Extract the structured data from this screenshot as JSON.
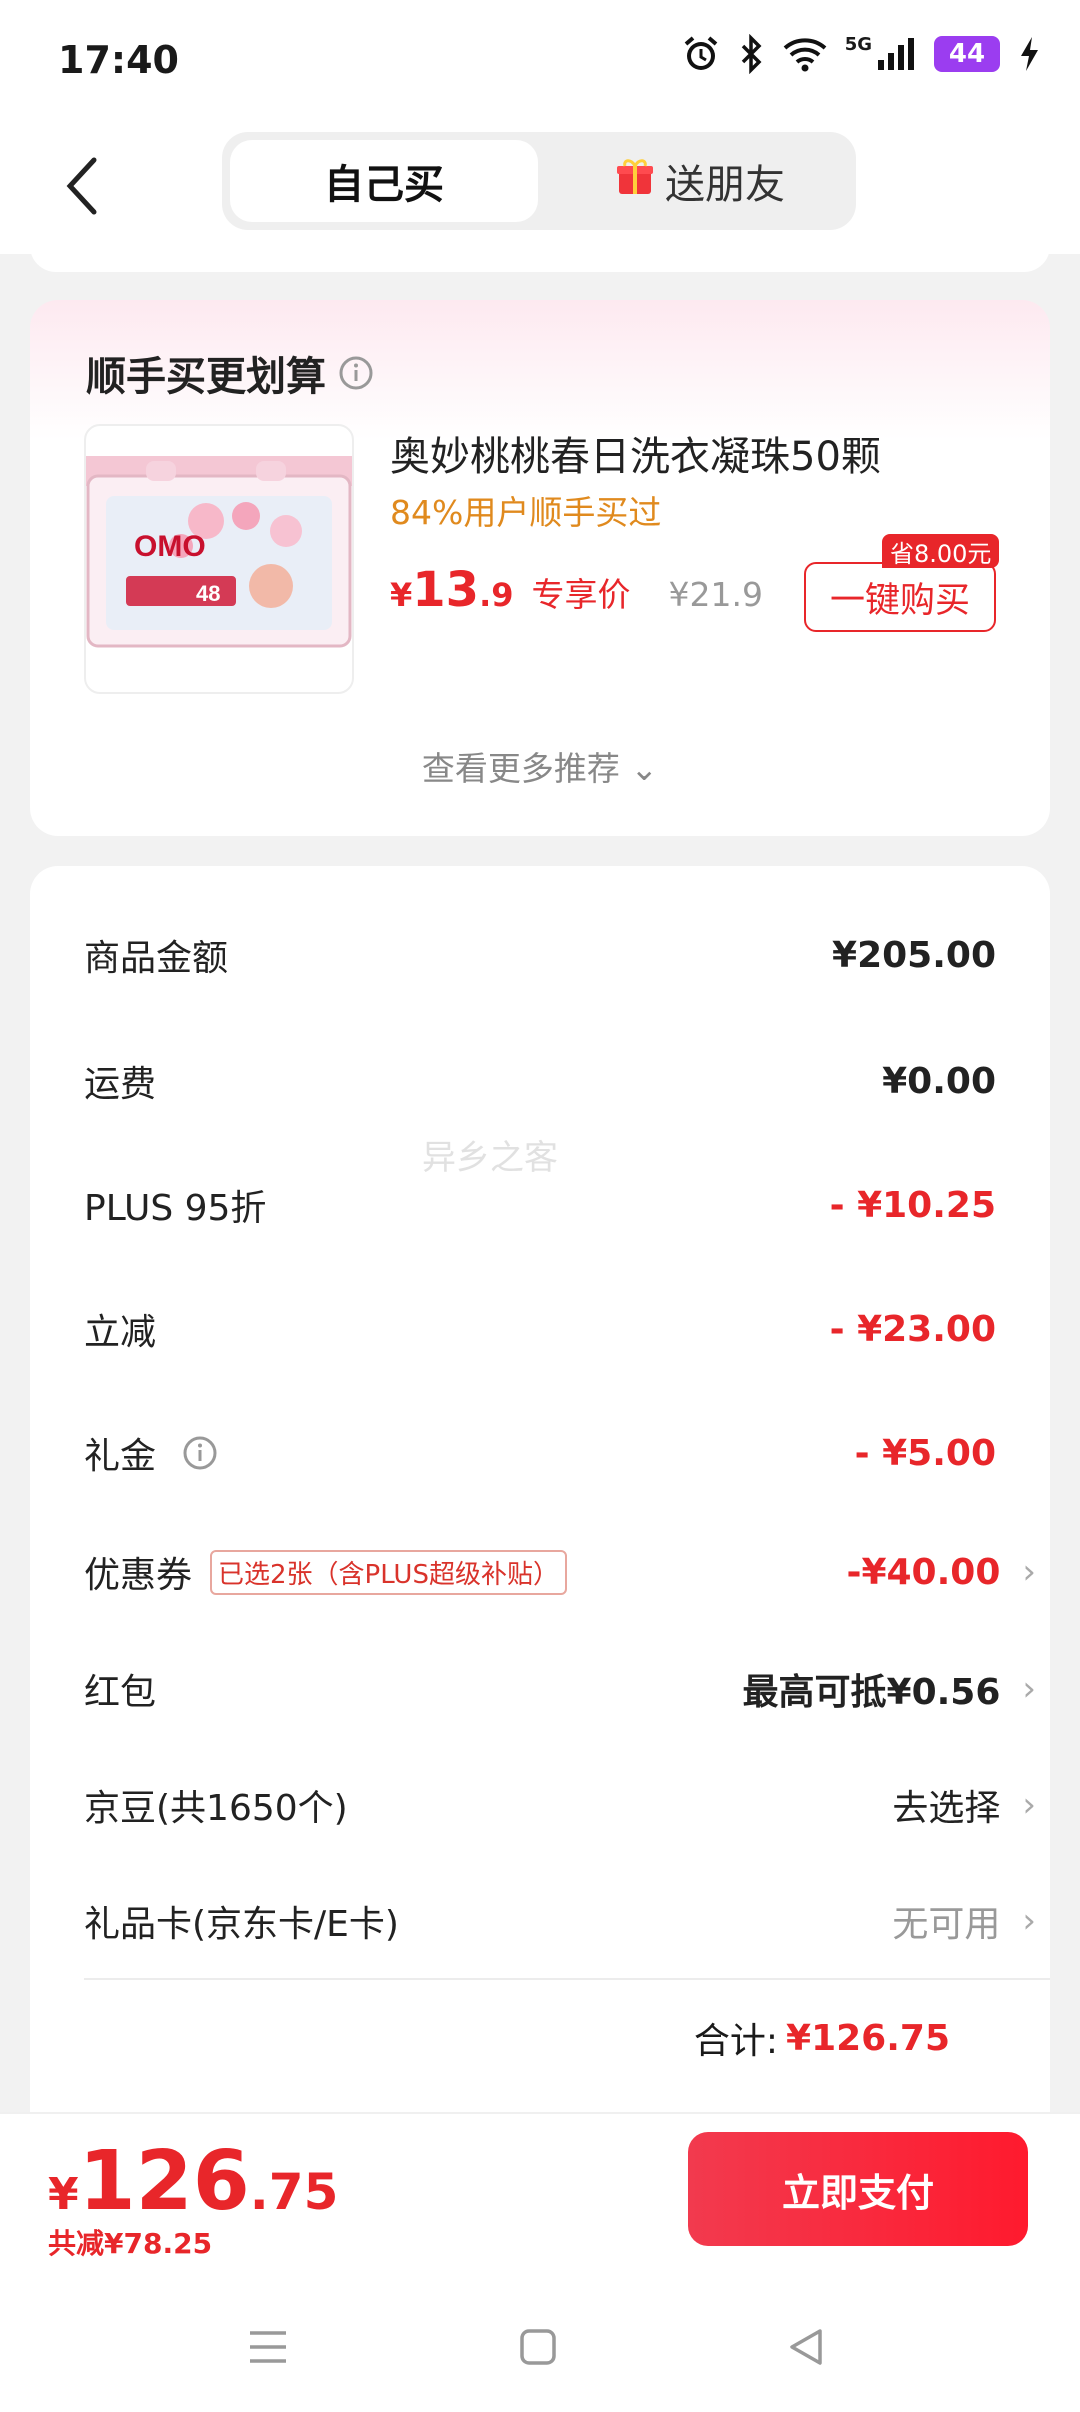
{
  "status_bar": {
    "time": "17:40",
    "network": "5G",
    "battery": "44"
  },
  "header": {
    "tab_self": "自己买",
    "tab_gift": "送朋友"
  },
  "recommend": {
    "title": "顺手买更划算",
    "product_name": "奥妙桃桃春日洗衣凝珠50颗",
    "product_sub": "84%用户顺手买过",
    "price_symbol": "¥",
    "price_int": "13",
    "price_dec": ".9",
    "price_tag": "专享价",
    "orig_price": "¥21.9",
    "save_badge": "省8.00元",
    "buy_label": "一键购买",
    "see_more": "查看更多推荐 ⌄",
    "img_brand": "OMO",
    "img_badge": "48"
  },
  "details": {
    "rows": [
      {
        "label": "商品金额",
        "value": "¥205.00"
      },
      {
        "label": "运费",
        "value": "¥0.00"
      },
      {
        "label": "PLUS 95折",
        "value": "- ¥10.25"
      },
      {
        "label": "立减",
        "value": "- ¥23.00"
      },
      {
        "label": "礼金",
        "value": "- ¥5.00"
      },
      {
        "label": "优惠券",
        "value": "-¥40.00",
        "tag": "已选2张（含PLUS超级补贴）"
      },
      {
        "label": "红包",
        "value": "最高可抵¥0.56"
      },
      {
        "label": "京豆(共1650个)",
        "value": "去选择"
      },
      {
        "label": "礼品卡(京东卡/E卡)",
        "value": "无可用"
      }
    ],
    "total_label": "合计:",
    "total_value": "¥126.75"
  },
  "bottom": {
    "price_symbol": "¥",
    "price_int": "126",
    "price_dec": ".75",
    "saved": "共减¥78.25",
    "pay_label": "立即支付"
  },
  "watermark": "异乡之客",
  "colors": {
    "accent_red": "#e8262a",
    "orange": "#e08a1e",
    "pay_gradient_start": "#f23a4e",
    "pay_gradient_end": "#ff1a2e"
  }
}
